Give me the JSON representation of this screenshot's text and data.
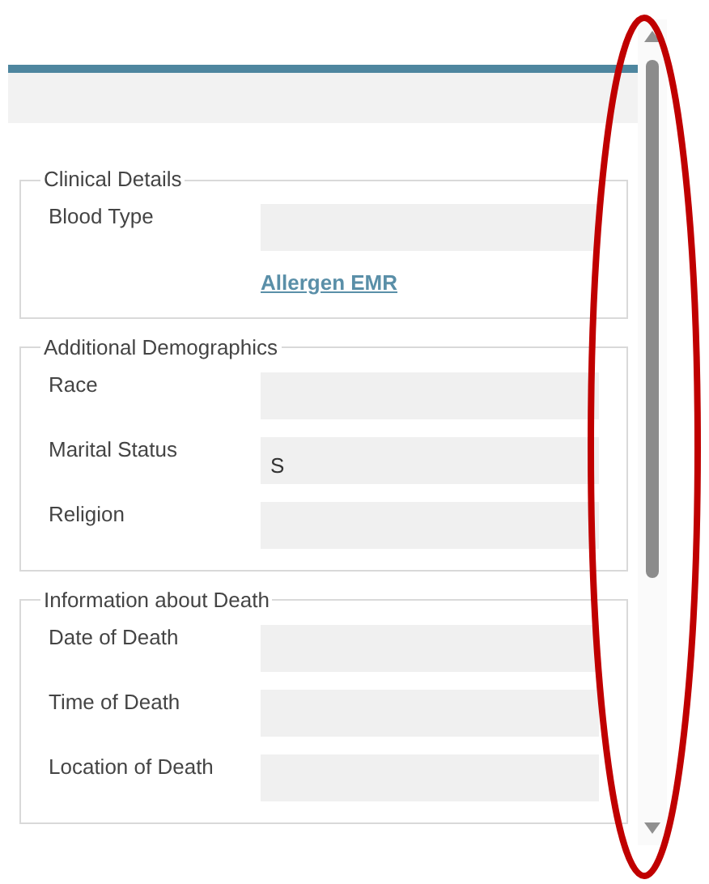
{
  "sections": [
    {
      "legend": "Clinical Details",
      "fields": [
        {
          "label": "Blood Type"
        }
      ],
      "link": "Allergen EMR"
    },
    {
      "legend": "Additional Demographics",
      "fields": [
        {
          "label": "Race"
        },
        {
          "label": "Marital Status",
          "value": "S"
        },
        {
          "label": "Religion"
        }
      ]
    },
    {
      "legend": "Information about Death",
      "fields": [
        {
          "label": "Date of Death"
        },
        {
          "label": "Time of Death"
        },
        {
          "label": "Location of Death"
        }
      ]
    }
  ]
}
